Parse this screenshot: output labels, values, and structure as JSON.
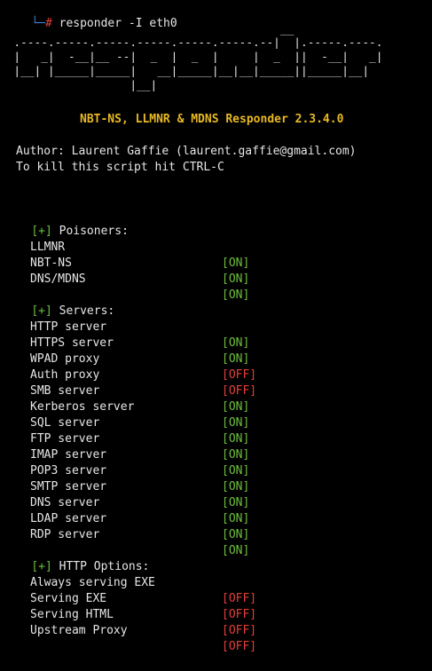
{
  "prompt": {
    "corner": "└─",
    "hash": "#",
    "command": " responder -I eth0"
  },
  "banner": {
    "lines": [
      "                                         __",
      "  .----.-----.-----.-----.-----.-----.--|  |.-----.----.",
      "  |   _|  -__|__ --|  _  |  _  |     |  _  ||  -__|   _|",
      "  |__| |_____|_____|   __|_____|__|__|_____||_____|__|",
      "                   |__|"
    ]
  },
  "title": "NBT-NS, LLMNR & MDNS Responder 2.3.4.0",
  "author": "Author: Laurent Gaffie (laurent.gaffie@gmail.com)",
  "kill_hint": "To kill this script hit CTRL-C",
  "sections": [
    {
      "marker": "[+]",
      "heading": "Poisoners:",
      "items": [
        {
          "label": "LLMNR",
          "status": "[ON]",
          "state": "on"
        },
        {
          "label": "NBT-NS",
          "status": "[ON]",
          "state": "on"
        },
        {
          "label": "DNS/MDNS",
          "status": "[ON]",
          "state": "on"
        }
      ]
    },
    {
      "marker": "[+]",
      "heading": "Servers:",
      "items": [
        {
          "label": "HTTP server",
          "status": "[ON]",
          "state": "on"
        },
        {
          "label": "HTTPS server",
          "status": "[ON]",
          "state": "on"
        },
        {
          "label": "WPAD proxy",
          "status": "[OFF]",
          "state": "off"
        },
        {
          "label": "Auth proxy",
          "status": "[OFF]",
          "state": "off"
        },
        {
          "label": "SMB server",
          "status": "[ON]",
          "state": "on"
        },
        {
          "label": "Kerberos server",
          "status": "[ON]",
          "state": "on"
        },
        {
          "label": "SQL server",
          "status": "[ON]",
          "state": "on"
        },
        {
          "label": "FTP server",
          "status": "[ON]",
          "state": "on"
        },
        {
          "label": "IMAP server",
          "status": "[ON]",
          "state": "on"
        },
        {
          "label": "POP3 server",
          "status": "[ON]",
          "state": "on"
        },
        {
          "label": "SMTP server",
          "status": "[ON]",
          "state": "on"
        },
        {
          "label": "DNS server",
          "status": "[ON]",
          "state": "on"
        },
        {
          "label": "LDAP server",
          "status": "[ON]",
          "state": "on"
        },
        {
          "label": "RDP server",
          "status": "[ON]",
          "state": "on"
        }
      ]
    },
    {
      "marker": "[+]",
      "heading": "HTTP Options:",
      "items": [
        {
          "label": "Always serving EXE",
          "status": "[OFF]",
          "state": "off"
        },
        {
          "label": "Serving EXE",
          "status": "[OFF]",
          "state": "off"
        },
        {
          "label": "Serving HTML",
          "status": "[OFF]",
          "state": "off"
        },
        {
          "label": "Upstream Proxy",
          "status": "[OFF]",
          "state": "off"
        }
      ]
    }
  ],
  "colors": {
    "background": "#000000",
    "text": "#e6e6e6",
    "title": "#e8b923",
    "on": "#6dbf3a",
    "off": "#e0403a",
    "prompt_corner": "#3d86d6",
    "prompt_hash": "#e0403a"
  }
}
